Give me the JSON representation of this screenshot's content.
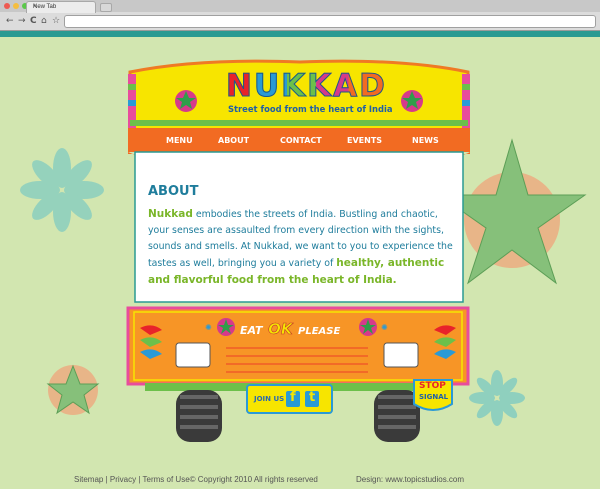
{
  "browser": {
    "tab_title": "New Tab",
    "tab_close": "×",
    "nav_back": "←",
    "nav_forward": "→",
    "nav_reload": "C",
    "nav_home": "⌂",
    "nav_star": "☆"
  },
  "site": {
    "logo_text": "NUKKAD",
    "tagline": "Street food from the heart of India",
    "nav": [
      "MENU",
      "ABOUT",
      "CONTACT",
      "EVENTS",
      "NEWS"
    ]
  },
  "about": {
    "title": "ABOUT",
    "intro_brand": "Nukkad",
    "intro_text": " embodies the streets of India. Bustling and chaotic, your senses are assaulted from every direction with the sights, sounds and smells. At Nukkad, we want to you to experience the tastes as well, bringing you a variety of ",
    "highlight": "healthy, authentic and flavorful food from the heart of India."
  },
  "truck": {
    "slogan_eat": "EAT",
    "slogan_ok": "OK",
    "slogan_please": "PLEASE",
    "join_us": "JOIN US",
    "facebook_letter": "f",
    "twitter_letter": "t",
    "stop_top": "STOP",
    "stop_bottom": "SIGNAL"
  },
  "footer": {
    "sitemap": "Sitemap",
    "sep1": "|",
    "privacy": "Privacy",
    "sep2": "|",
    "terms": "Terms of Use",
    "copyright": "© Copyright 2010  All rights reserved",
    "design": "Design: www.topicstudios.com"
  },
  "colors": {
    "background": "#d2e6b0",
    "teal": "#2a9a92",
    "orange": "#f26b22",
    "yellow": "#f7e500",
    "green": "#7ab629",
    "blue_text": "#1f7d9c"
  }
}
